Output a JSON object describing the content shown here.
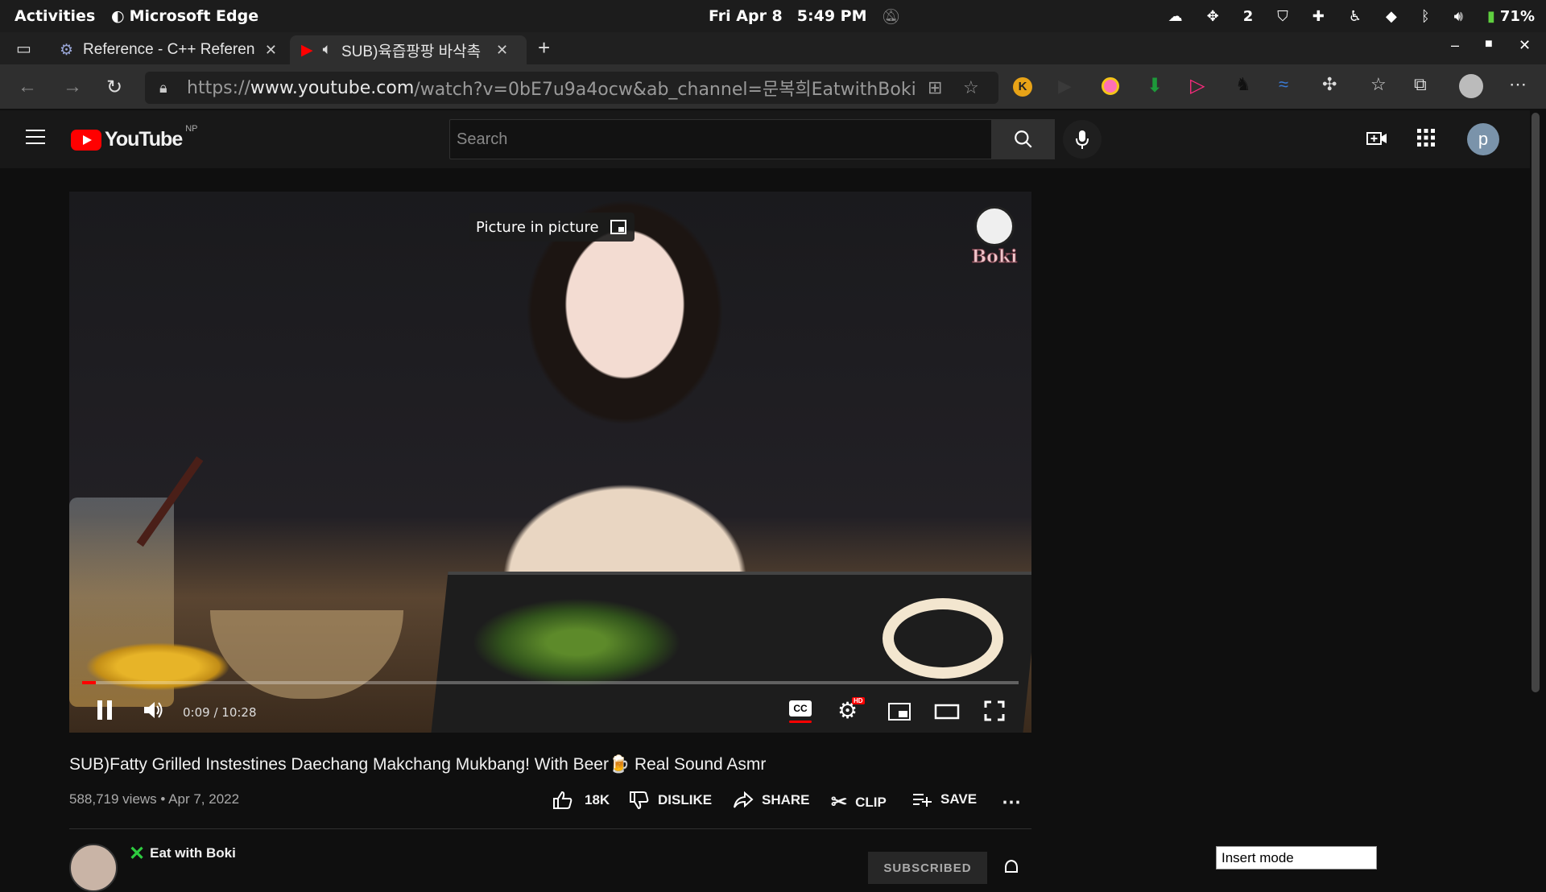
{
  "system_bar": {
    "activities": "Activities",
    "app_name": "Microsoft Edge",
    "date": "Fri Apr 8",
    "time": "5:49 PM",
    "workspace": "2",
    "battery": "71%"
  },
  "tabs": [
    {
      "title": "Reference - C++ Referenc",
      "active": false
    },
    {
      "title": "SUB)육즙팡팡 바삭촉",
      "active": true
    }
  ],
  "address_bar": {
    "scheme": "https://",
    "host": "www.youtube.com",
    "path": "/watch?v=0bE7u9a4ocw&ab_channel=문복희EatwithBoki"
  },
  "youtube": {
    "logo_text": "YouTube",
    "country_code": "NP",
    "search_placeholder": "Search",
    "avatar_letter": "p"
  },
  "player": {
    "pip_tooltip": "Picture in picture",
    "watermark": "Boki",
    "time_current": "0:09",
    "time_separator": " / ",
    "time_total": "10:28",
    "progress": 0.0143,
    "hd_badge": "HD"
  },
  "video": {
    "title": "SUB)Fatty Grilled Instestines Daechang Makchang Mukbang! With Beer🍺 Real Sound Asmr",
    "views": "588,719 views",
    "date": "Apr 7, 2022",
    "like_count": "18K",
    "dislike_label": "DISLIKE",
    "share_label": "SHARE",
    "clip_label": "CLIP",
    "save_label": "SAVE"
  },
  "channel": {
    "name": "Eat with Boki",
    "subscribed_label": "SUBSCRIBED"
  },
  "vim_status": "Insert mode",
  "colors": {
    "youtube_red": "#ff0000",
    "background": "#0f0f0f"
  }
}
